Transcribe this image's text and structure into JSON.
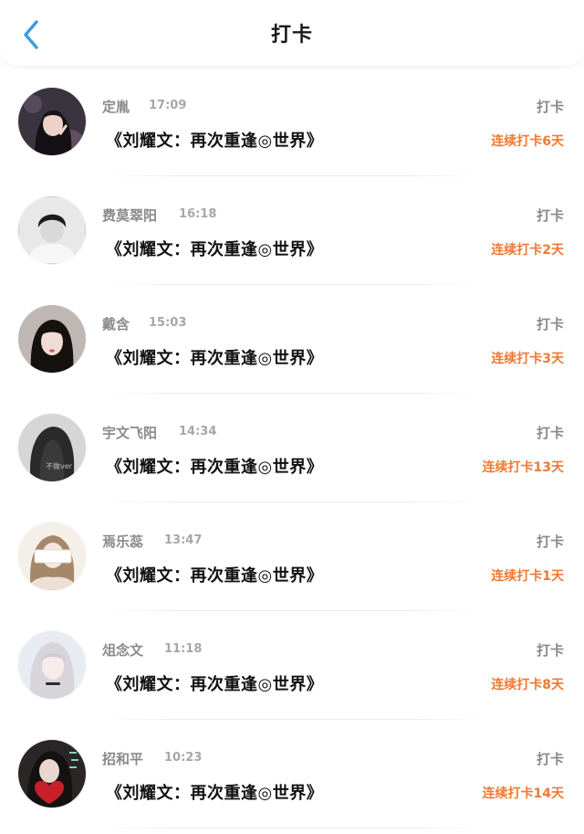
{
  "header": {
    "title": "打卡",
    "back_icon": "chevron-left-icon",
    "accent_color": "#3a9de0"
  },
  "colors": {
    "streak": "#ee7a34",
    "muted": "#8a8a8a"
  },
  "records": [
    {
      "name": "定胤",
      "time": "17:09",
      "book": "《刘耀文：再次重逢◎世界》",
      "label": "打卡",
      "streak": "连续打卡6天"
    },
    {
      "name": "费莫翠阳",
      "time": "16:18",
      "book": "《刘耀文：再次重逢◎世界》",
      "label": "打卡",
      "streak": "连续打卡2天"
    },
    {
      "name": "戴含",
      "time": "15:03",
      "book": "《刘耀文：再次重逢◎世界》",
      "label": "打卡",
      "streak": "连续打卡3天"
    },
    {
      "name": "宇文飞阳",
      "time": "14:34",
      "book": "《刘耀文：再次重逢◎世界》",
      "label": "打卡",
      "streak": "连续打卡13天",
      "avatar_text": "不做ver"
    },
    {
      "name": "焉乐蕊",
      "time": "13:47",
      "book": "《刘耀文：再次重逢◎世界》",
      "label": "打卡",
      "streak": "连续打卡1天"
    },
    {
      "name": "俎念文",
      "time": "11:18",
      "book": "《刘耀文：再次重逢◎世界》",
      "label": "打卡",
      "streak": "连续打卡8天"
    },
    {
      "name": "招和平",
      "time": "10:23",
      "book": "《刘耀文：再次重逢◎世界》",
      "label": "打卡",
      "streak": "连续打卡14天"
    }
  ]
}
